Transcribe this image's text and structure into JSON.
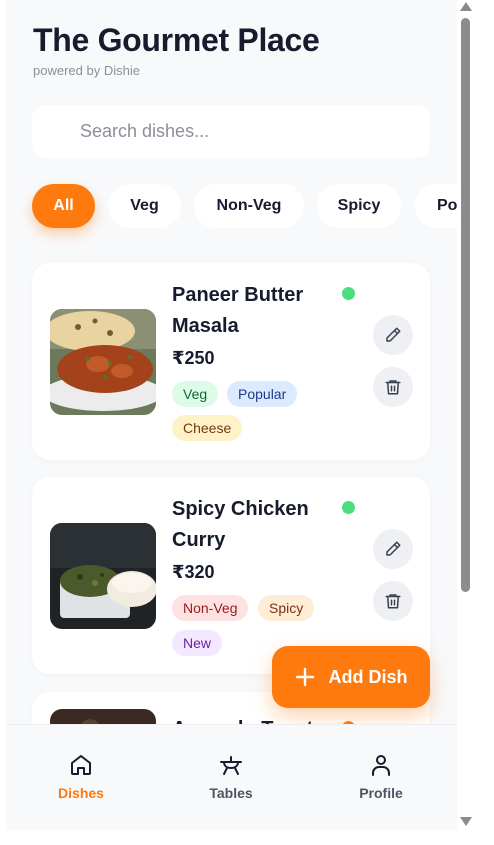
{
  "header": {
    "title": "The Gourmet Place",
    "subtitle": "powered by Dishie"
  },
  "search": {
    "placeholder": "Search dishes...",
    "value": ""
  },
  "filters": [
    {
      "label": "All",
      "active": true
    },
    {
      "label": "Veg",
      "active": false
    },
    {
      "label": "Non-Veg",
      "active": false
    },
    {
      "label": "Spicy",
      "active": false
    },
    {
      "label": "Po",
      "active": false
    }
  ],
  "dishes": [
    {
      "name_line1": "Paneer Butter",
      "name_line2": "Masala",
      "price": "₹250",
      "available": true,
      "status_color": "#4ade80",
      "tags": [
        "Veg",
        "Popular",
        "Cheese"
      ]
    },
    {
      "name_line1": "Spicy Chicken",
      "name_line2": "Curry",
      "price": "₹320",
      "available": true,
      "status_color": "#4ade80",
      "tags": [
        "Non-Veg",
        "Spicy",
        "New"
      ]
    },
    {
      "name_line1": "Avocado Toast",
      "status_color": "#ff7a0e"
    }
  ],
  "fab": {
    "label": "Add Dish",
    "icon": "plus-icon"
  },
  "bottom_nav": [
    {
      "label": "Dishes",
      "icon": "home-icon",
      "active": true
    },
    {
      "label": "Tables",
      "icon": "table-icon",
      "active": false
    },
    {
      "label": "Profile",
      "icon": "user-icon",
      "active": false
    }
  ],
  "colors": {
    "accent": "#ff7a0e",
    "available": "#4ade80",
    "background": "#f8f9fb"
  }
}
